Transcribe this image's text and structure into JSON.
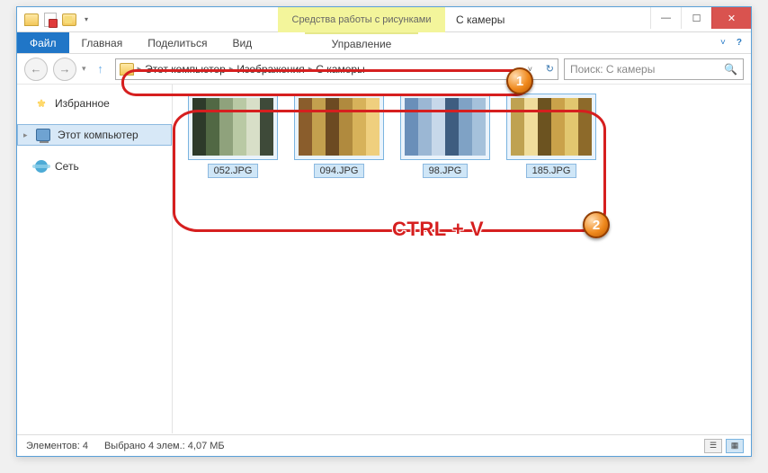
{
  "title": "С камеры",
  "context_tab": "Средства работы с рисунками",
  "ribbon": {
    "file": "Файл",
    "home": "Главная",
    "share": "Поделиться",
    "view": "Вид",
    "ctx": "Управление"
  },
  "breadcrumbs": [
    "Этот компьютер",
    "Изображения",
    "С камеры"
  ],
  "search_placeholder": "Поиск: С камеры",
  "sidebar": {
    "fav": "Избранное",
    "pc": "Этот компьютер",
    "net": "Сеть"
  },
  "files": [
    {
      "name": "052.JPG"
    },
    {
      "name": "094.JPG"
    },
    {
      "name": "98.JPG"
    },
    {
      "name": "185.JPG"
    }
  ],
  "status": {
    "count_label": "Элементов: 4",
    "sel_label": "Выбрано 4 элем.: 4,07 МБ"
  },
  "annotation": {
    "badge1": "1",
    "badge2": "2",
    "shortcut": "CTRL + V"
  },
  "mosaic_palettes": [
    [
      "#2d3a2a",
      "#516844",
      "#8fa27c",
      "#b9c9a4",
      "#d8dfc8",
      "#3e4a39"
    ],
    [
      "#b08a3e",
      "#d7b25a",
      "#efcf7e",
      "#8a5d2c",
      "#c3a04e",
      "#6c4a22"
    ],
    [
      "#6a8fb9",
      "#9bb7d4",
      "#c7d8ea",
      "#3e5d80",
      "#7fa2c5",
      "#a5c1db"
    ],
    [
      "#caa24a",
      "#e2c76f",
      "#8d6a2a",
      "#bfa251",
      "#f0dd9b",
      "#6c5320"
    ]
  ]
}
